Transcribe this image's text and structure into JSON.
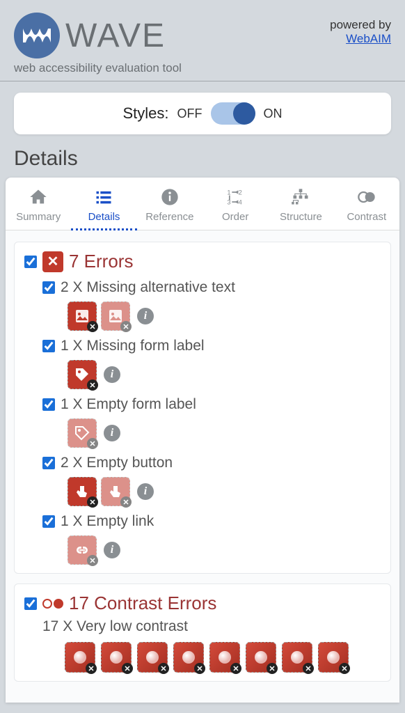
{
  "header": {
    "title": "WAVE",
    "subtitle": "web accessibility evaluation tool",
    "powered_by": "powered by",
    "powered_link": "WebAIM"
  },
  "styles_toggle": {
    "label": "Styles:",
    "off": "OFF",
    "on": "ON",
    "state": "on"
  },
  "section_heading": "Details",
  "tabs": [
    {
      "id": "summary",
      "label": "Summary"
    },
    {
      "id": "details",
      "label": "Details"
    },
    {
      "id": "reference",
      "label": "Reference"
    },
    {
      "id": "order",
      "label": "Order"
    },
    {
      "id": "structure",
      "label": "Structure"
    },
    {
      "id": "contrast",
      "label": "Contrast"
    }
  ],
  "active_tab": "details",
  "categories": [
    {
      "id": "errors",
      "count": 7,
      "title": "7 Errors",
      "checked": true,
      "issues": [
        {
          "count": 2,
          "label": "2 X Missing alternative text",
          "icon": "image",
          "instances": 2,
          "checked": true
        },
        {
          "count": 1,
          "label": "1 X Missing form label",
          "icon": "tag",
          "instances": 1,
          "checked": true
        },
        {
          "count": 1,
          "label": "1 X Empty form label",
          "icon": "tag-outline",
          "instances": 1,
          "checked": true
        },
        {
          "count": 2,
          "label": "2 X Empty button",
          "icon": "button",
          "instances": 2,
          "checked": true
        },
        {
          "count": 1,
          "label": "1 X Empty link",
          "icon": "link",
          "instances": 1,
          "checked": true
        }
      ]
    },
    {
      "id": "contrast",
      "count": 17,
      "title": "17 Contrast Errors",
      "checked": true,
      "sub_label": "17 X Very low contrast",
      "visible_instances": 8
    }
  ]
}
